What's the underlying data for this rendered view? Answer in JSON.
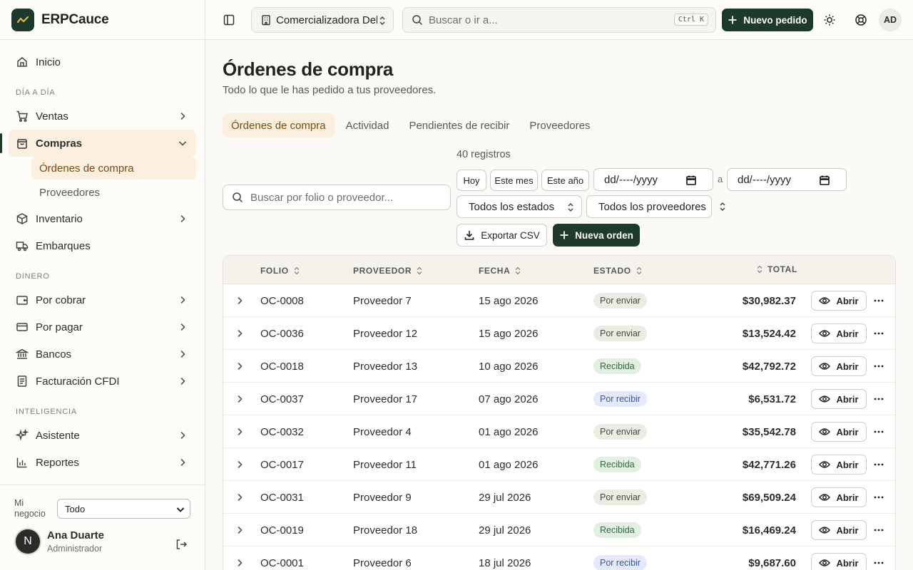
{
  "app": {
    "name": "ERPCauce"
  },
  "sidebar": {
    "inicio": "Inicio",
    "sections": {
      "dia": "DÍA A DÍA",
      "dinero": "DINERO",
      "inteligencia": "INTELIGENCIA"
    },
    "ventas": "Ventas",
    "compras": "Compras",
    "sub_ordenes": "Órdenes de compra",
    "sub_proveedores": "Proveedores",
    "inventario": "Inventario",
    "embarques": "Embarques",
    "por_cobrar": "Por cobrar",
    "por_pagar": "Por pagar",
    "bancos": "Bancos",
    "facturacion": "Facturación CFDI",
    "asistente": "Asistente",
    "reportes": "Reportes",
    "business_label": "Mi negocio",
    "business_value": "Todo",
    "user": {
      "initial": "N",
      "name": "Ana Duarte",
      "role": "Administrador"
    }
  },
  "topbar": {
    "company": "Comercializadora Del Norte",
    "search_placeholder": "Buscar o ir a...",
    "shortcut": "Ctrl K",
    "new_order": "Nuevo pedido",
    "avatar": "AD"
  },
  "page": {
    "title": "Órdenes de compra",
    "subtitle": "Todo lo que le has pedido a tus proveedores.",
    "tabs": [
      "Órdenes de compra",
      "Actividad",
      "Pendientes de recibir",
      "Proveedores"
    ],
    "count": "40 registros",
    "search_placeholder": "Buscar por folio o proveedor...",
    "chips": {
      "hoy": "Hoy",
      "mes": "Este mes",
      "anio": "Este año"
    },
    "date_from": "dd/----/yyyy",
    "date_sep": "a",
    "date_to": "dd/----/yyyy",
    "status_select": "Todos los estados",
    "supplier_select": "Todos los proveedores",
    "export": "Exportar CSV",
    "new_order": "Nueva orden"
  },
  "table": {
    "headers": {
      "folio": "FOLIO",
      "proveedor": "PROVEEDOR",
      "fecha": "FECHA",
      "estado": "ESTADO",
      "total": "TOTAL"
    },
    "open_label": "Abrir",
    "rows": [
      {
        "folio": "OC-0008",
        "proveedor": "Proveedor 7",
        "fecha": "15 ago 2026",
        "estado": "Por enviar",
        "total": "$30,982.37"
      },
      {
        "folio": "OC-0036",
        "proveedor": "Proveedor 12",
        "fecha": "15 ago 2026",
        "estado": "Por enviar",
        "total": "$13,524.42"
      },
      {
        "folio": "OC-0018",
        "proveedor": "Proveedor 13",
        "fecha": "10 ago 2026",
        "estado": "Recibida",
        "total": "$42,792.72"
      },
      {
        "folio": "OC-0037",
        "proveedor": "Proveedor 17",
        "fecha": "07 ago 2026",
        "estado": "Por recibir",
        "total": "$6,531.72"
      },
      {
        "folio": "OC-0032",
        "proveedor": "Proveedor 4",
        "fecha": "01 ago 2026",
        "estado": "Por enviar",
        "total": "$35,542.78"
      },
      {
        "folio": "OC-0017",
        "proveedor": "Proveedor 11",
        "fecha": "01 ago 2026",
        "estado": "Recibida",
        "total": "$42,771.26"
      },
      {
        "folio": "OC-0031",
        "proveedor": "Proveedor 9",
        "fecha": "29 jul 2026",
        "estado": "Por enviar",
        "total": "$69,509.24"
      },
      {
        "folio": "OC-0019",
        "proveedor": "Proveedor 18",
        "fecha": "29 jul 2026",
        "estado": "Recibida",
        "total": "$16,469.24"
      },
      {
        "folio": "OC-0001",
        "proveedor": "Proveedor 6",
        "fecha": "18 jul 2026",
        "estado": "Por recibir",
        "total": "$9,687.60"
      }
    ]
  },
  "colors": {
    "brand": "#1d3a2b",
    "accent_bg": "#fbefe0",
    "accent_text": "#7a4a10"
  }
}
